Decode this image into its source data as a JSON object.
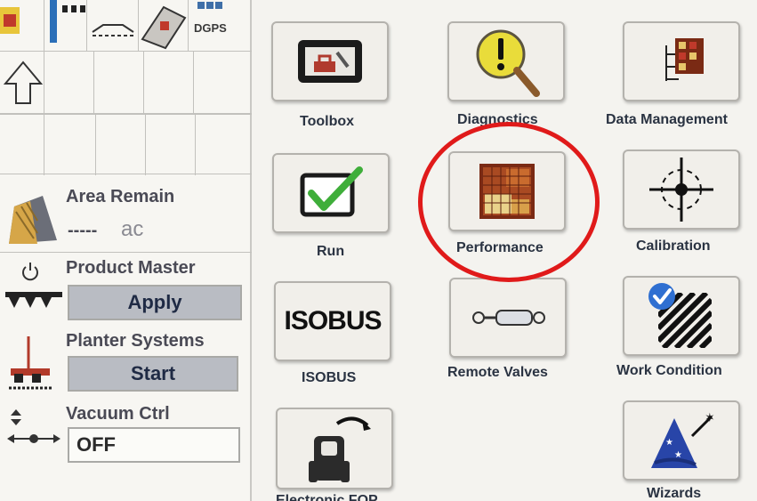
{
  "status_bar": {
    "gps_label": "DGPS"
  },
  "left_panel": {
    "area_remain": {
      "label": "Area Remain",
      "value": "-----",
      "unit": "ac"
    },
    "product_master": {
      "label": "Product Master",
      "button": "Apply"
    },
    "planter_systems": {
      "label": "Planter Systems",
      "button": "Start"
    },
    "vacuum_ctrl": {
      "label": "Vacuum Ctrl",
      "value": "OFF"
    }
  },
  "apps": [
    {
      "label": "Toolbox",
      "icon": "toolbox-icon"
    },
    {
      "label": "Diagnostics",
      "icon": "magnifier-warning-icon"
    },
    {
      "label": "Data Management",
      "icon": "data-management-icon"
    },
    {
      "label": "Run",
      "icon": "checkmark-icon"
    },
    {
      "label": "Performance",
      "icon": "performance-map-icon"
    },
    {
      "label": "Calibration",
      "icon": "crosshair-icon"
    },
    {
      "label": "ISOBUS",
      "icon": "isobus-icon",
      "icon_text": "ISOBUS"
    },
    {
      "label": "Remote Valves",
      "icon": "hydraulic-cylinder-icon"
    },
    {
      "label": "Work Condition",
      "icon": "work-condition-icon"
    },
    {
      "label": "Electronic FOP",
      "icon": "tractor-fop-icon"
    },
    {
      "label": "Wizards",
      "icon": "wizard-hat-icon"
    }
  ],
  "highlight": {
    "target": "Performance",
    "color": "#e01a1a"
  }
}
